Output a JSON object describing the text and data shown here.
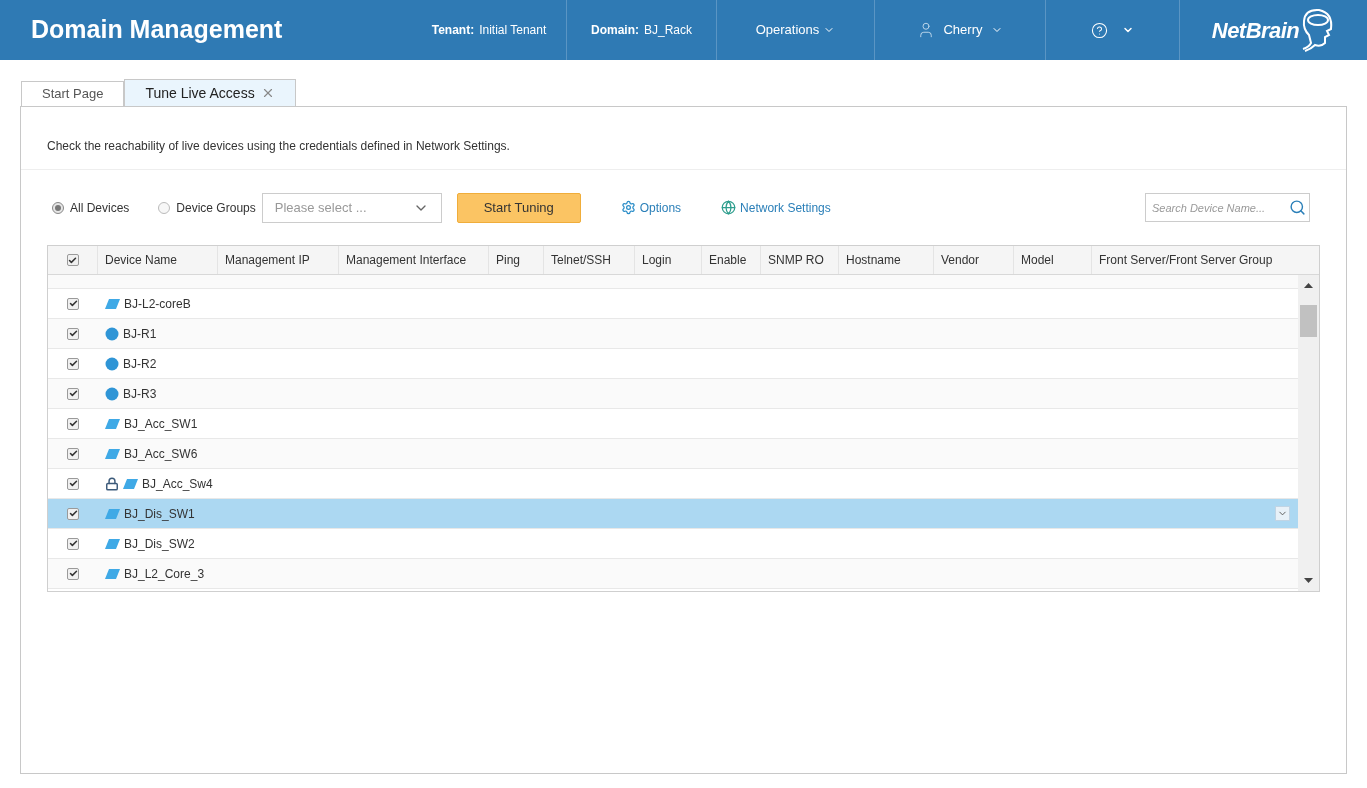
{
  "header": {
    "title": "Domain Management",
    "tenant": {
      "label": "Tenant:",
      "value": "Initial Tenant"
    },
    "domain": {
      "label": "Domain:",
      "value": "BJ_Rack"
    },
    "menu": "Operations",
    "user": "Cherry",
    "logo": "NetBrain"
  },
  "tabs": [
    {
      "label": "Start Page",
      "selected": false,
      "closable": false
    },
    {
      "label": "Tune Live Access",
      "selected": true,
      "closable": true
    }
  ],
  "description": "Check the reachability of live devices using the credentials defined in Network Settings.",
  "scope": [
    {
      "label": "All Devices",
      "selected": true
    },
    {
      "label": "Device Groups",
      "selected": false
    }
  ],
  "group_select": {
    "placeholder": "Please select ..."
  },
  "start_button": "Start Tuning",
  "links": [
    {
      "kind": "options",
      "label": "Options"
    },
    {
      "kind": "network",
      "label": "Network Settings"
    }
  ],
  "search": {
    "placeholder": "Search Device Name..."
  },
  "table": {
    "select_all": true,
    "columns": [
      "Device Name",
      "Management IP",
      "Management Interface",
      "Ping",
      "Telnet/SSH",
      "Login",
      "Enable",
      "SNMP RO",
      "Hostname",
      "Vendor",
      "Model",
      "Front Server/Front Server Group"
    ],
    "rows": [
      {
        "name": "BJ-L2-coreB",
        "kind": "switch",
        "checked": true,
        "locked": false,
        "selected": false
      },
      {
        "name": "BJ-R1",
        "kind": "router",
        "checked": true,
        "locked": false,
        "selected": false
      },
      {
        "name": "BJ-R2",
        "kind": "router",
        "checked": true,
        "locked": false,
        "selected": false
      },
      {
        "name": "BJ-R3",
        "kind": "router",
        "checked": true,
        "locked": false,
        "selected": false
      },
      {
        "name": "BJ_Acc_SW1",
        "kind": "switch",
        "checked": true,
        "locked": false,
        "selected": false
      },
      {
        "name": "BJ_Acc_SW6",
        "kind": "switch",
        "checked": true,
        "locked": false,
        "selected": false
      },
      {
        "name": "BJ_Acc_Sw4",
        "kind": "switch",
        "checked": true,
        "locked": true,
        "selected": false
      },
      {
        "name": "BJ_Dis_SW1",
        "kind": "switch",
        "checked": true,
        "locked": false,
        "selected": true
      },
      {
        "name": "BJ_Dis_SW2",
        "kind": "switch",
        "checked": true,
        "locked": false,
        "selected": false
      },
      {
        "name": "BJ_L2_Core_3",
        "kind": "switch",
        "checked": true,
        "locked": false,
        "selected": false
      }
    ]
  }
}
